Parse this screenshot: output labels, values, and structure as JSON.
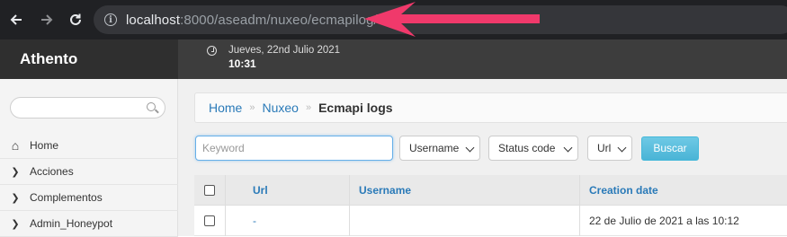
{
  "browser": {
    "url_host": "localhost",
    "url_path": ":8000/aseadm/nuxeo/ecmapilog/",
    "info_glyph": "i",
    "back_icon": "arrow-left-icon",
    "forward_icon": "arrow-right-icon",
    "reload_icon": "reload-icon",
    "annotation_color": "#f0396b"
  },
  "header": {
    "brand": "Athento",
    "date": "Jueves, 22nd Julio 2021",
    "time": "10:31"
  },
  "sidebar": {
    "items": [
      {
        "label": "Home",
        "icon": "home-icon",
        "glyph": "⌂"
      },
      {
        "label": "Acciones",
        "icon": "chevron-right-icon",
        "glyph": "❯"
      },
      {
        "label": "Complementos",
        "icon": "chevron-right-icon",
        "glyph": "❯"
      },
      {
        "label": "Admin_Honeypot",
        "icon": "chevron-right-icon",
        "glyph": "❯"
      }
    ]
  },
  "breadcrumb": {
    "home": "Home",
    "nuxeo": "Nuxeo",
    "current": "Ecmapi logs",
    "sep": "»"
  },
  "filters": {
    "keyword_placeholder": "Keyword",
    "username": "Username",
    "status_code": "Status code",
    "url": "Url",
    "search_button": "Buscar"
  },
  "table": {
    "columns": [
      "Url",
      "Username",
      "Creation date"
    ],
    "rows": [
      {
        "url": "-",
        "username": "",
        "creation_date": "22 de Julio de 2021 a las 10:12"
      }
    ]
  },
  "colors": {
    "link": "#2a7ab8",
    "button": "#5bc0de",
    "header_bg": "#3d3d3d"
  }
}
